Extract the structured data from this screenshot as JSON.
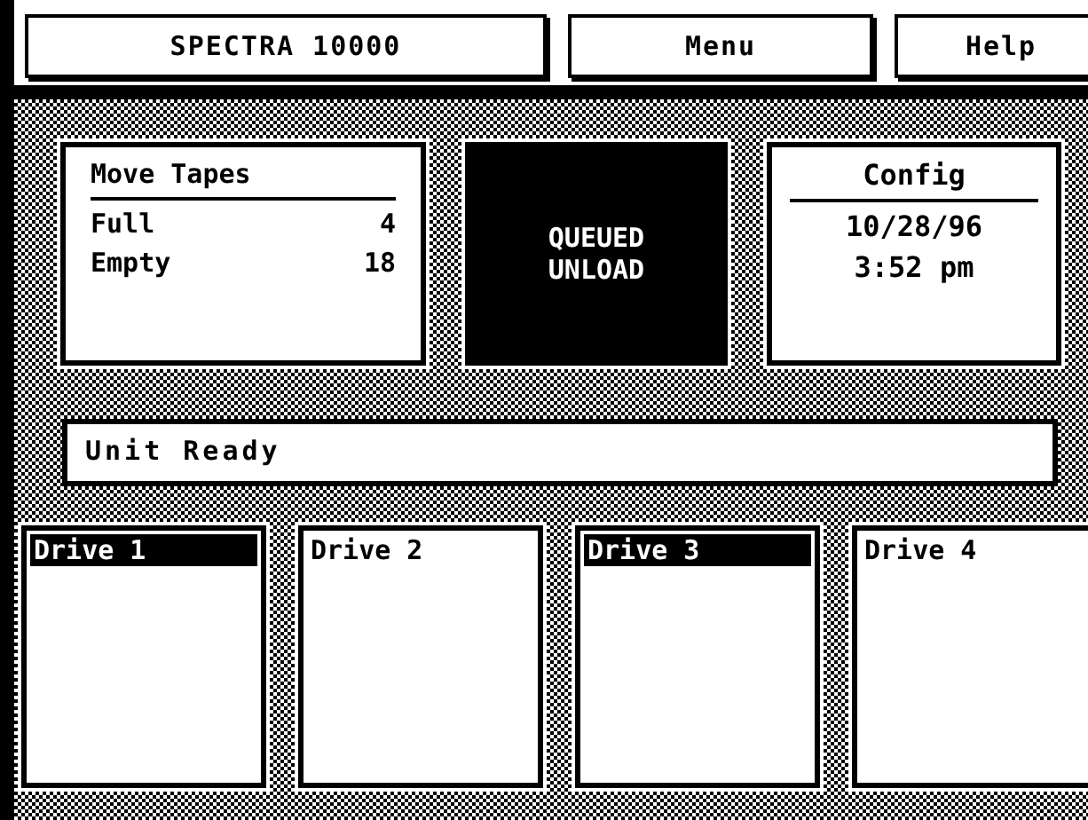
{
  "top_bar": {
    "title": "SPECTRA 10000",
    "menu": "Menu",
    "help": "Help"
  },
  "move_tapes": {
    "title": "Move Tapes",
    "rows": [
      {
        "label": "Full",
        "value": "4"
      },
      {
        "label": "Empty",
        "value": "18"
      }
    ]
  },
  "queue_status": {
    "lines": [
      "QUEUED",
      "UNLOAD"
    ]
  },
  "config": {
    "title": "Config",
    "date": "10/28/96",
    "time": "3:52 pm"
  },
  "status_message": "Unit Ready",
  "drives": [
    {
      "label": "Drive 1",
      "selected": true
    },
    {
      "label": "Drive 2",
      "selected": false
    },
    {
      "label": "Drive 3",
      "selected": true
    },
    {
      "label": "Drive 4",
      "selected": false
    }
  ]
}
